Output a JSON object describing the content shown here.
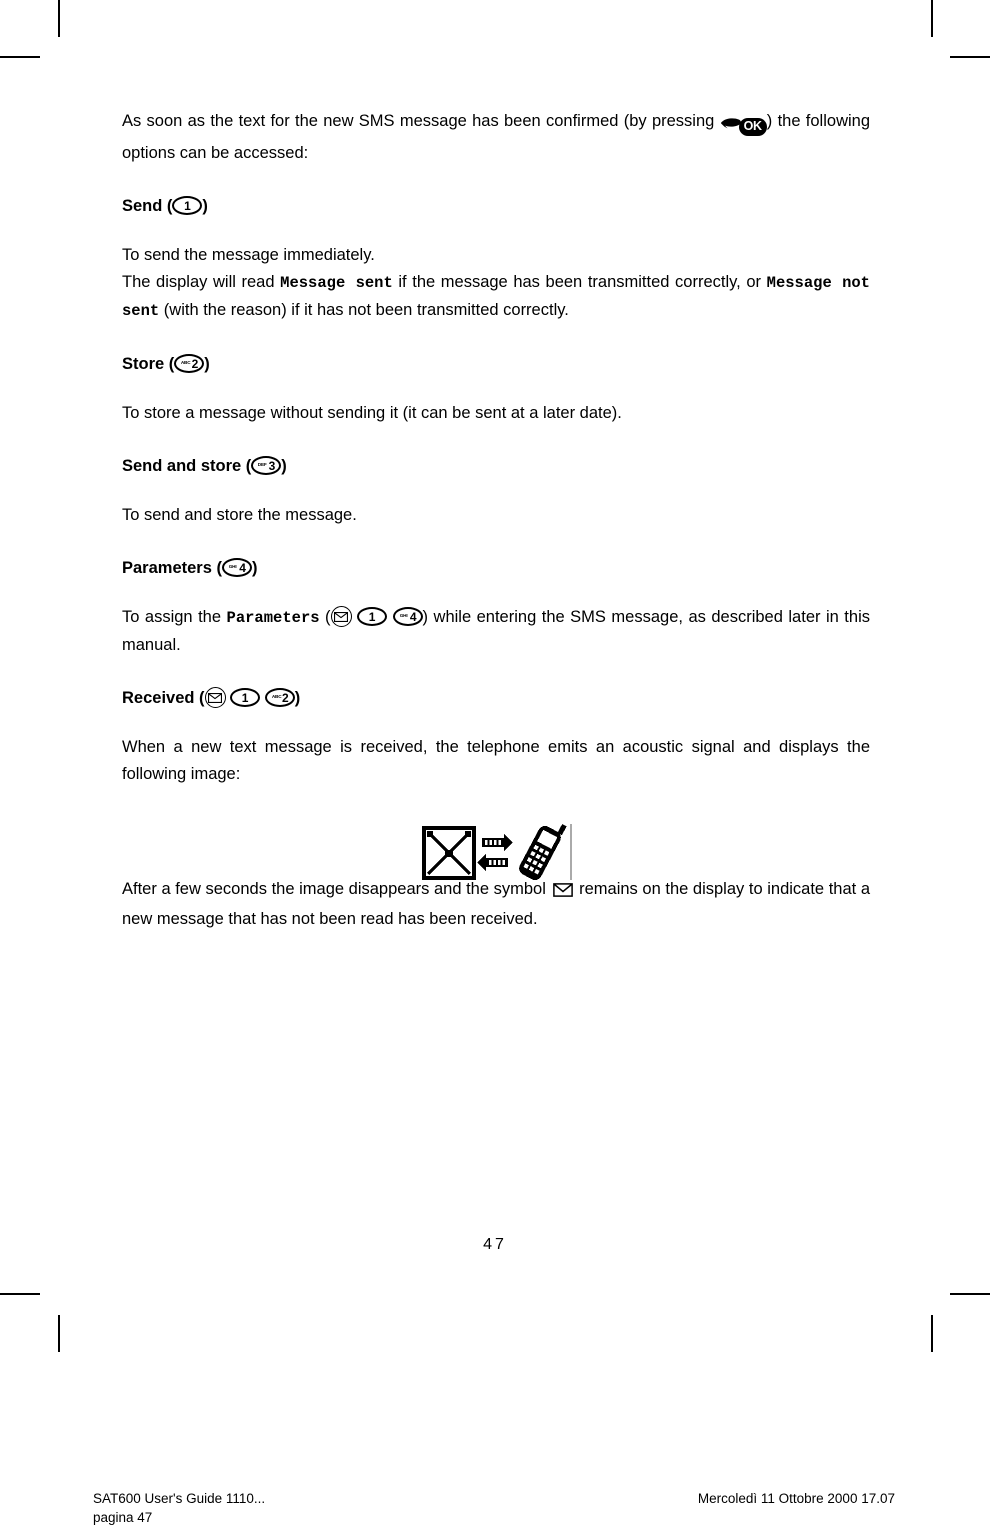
{
  "document": {
    "page_number": "47",
    "footer_left_line1": "SAT600 User's Guide 1110...",
    "footer_left_line2": "pagina 47",
    "footer_right": "Mercoledì 11 Ottobre 2000 17.07"
  },
  "intro": {
    "text_before_key": "As soon as the text for the new SMS message has been confirmed (by pressing ",
    "text_after_key": ") the following options can be accessed:",
    "ok_key_label": "OK"
  },
  "sections": [
    {
      "id": "send",
      "heading_text": "Send (",
      "heading_tail": ")",
      "key": {
        "type": "oval",
        "digit": "1",
        "letters": ""
      },
      "body_line1": "To send the message immediately.",
      "body_line2_a": "The display will read ",
      "body_line2_mono": "Message  sent",
      "body_line2_b": " if the message has been transmitted correctly, or ",
      "body_line3_mono": "Message not sent",
      "body_line3_b": " (with the reason) if it has not been transmitted correctly."
    },
    {
      "id": "store",
      "heading_text": "Store (",
      "heading_tail": ")",
      "key": {
        "type": "oval",
        "digit": "2",
        "letters": "ABC"
      },
      "body": "To store a message without sending it (it can be sent at a later date)."
    },
    {
      "id": "send-and-store",
      "heading_text": "Send and store (",
      "heading_tail": ")",
      "key": {
        "type": "oval",
        "digit": "3",
        "letters": "DEF"
      },
      "body": "To send and store the message."
    },
    {
      "id": "parameters",
      "heading_text": "Parameters (",
      "heading_tail": ")",
      "key": {
        "type": "oval",
        "digit": "4",
        "letters": "GHI"
      },
      "body_a": "To assign the ",
      "body_mono": "Parameters",
      "body_b": " (",
      "body_c": ") while entering the SMS message, as described later in this manual."
    },
    {
      "id": "received",
      "heading_text": "Received (",
      "heading_tail": ")",
      "keys": [
        {
          "type": "circle-envelope"
        },
        {
          "type": "oval",
          "digit": "1",
          "letters": ""
        },
        {
          "type": "oval",
          "digit": "2",
          "letters": "ABC"
        }
      ],
      "body": "When a new text message is received, the telephone emits an acoustic signal and displays the following image:",
      "after_figure_a": "After a few seconds the image disappears and the symbol ",
      "after_figure_b": " remains on the display to indicate that a new message that has not been read has been received."
    }
  ],
  "figure": {
    "caption": "",
    "elements": [
      "envelope-crossed-icon",
      "bidirectional-arrows-icon",
      "mobile-phone-icon"
    ]
  },
  "colors": {
    "ink": "#000000",
    "paper": "#ffffff",
    "figure_divider": "#aaaaaa"
  }
}
